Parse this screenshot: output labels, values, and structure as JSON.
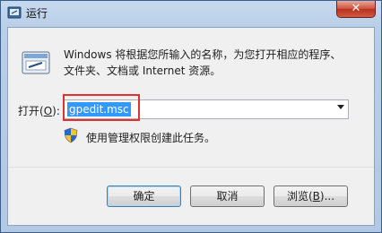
{
  "window": {
    "title": "运行",
    "close_symbol": "✕"
  },
  "dialog": {
    "description_line1": "Windows 将根据您所输入的名称，为您打开相应的程序、",
    "description_line2": "文件夹、文档或 Internet 资源。",
    "open_label_prefix": "打开(",
    "open_label_key": "O",
    "open_label_suffix": "):",
    "command_value": "gpedit.msc",
    "admin_note": "使用管理权限创建此任务。"
  },
  "buttons": {
    "ok_label": "确定",
    "cancel_label": "取消",
    "browse_prefix": "浏览(",
    "browse_key": "B",
    "browse_suffix": ")..."
  },
  "colors": {
    "highlight": "#e03030",
    "selection": "#3399ff"
  },
  "icons": [
    "run-app-icon",
    "run-program-icon",
    "uac-shield-icon",
    "dropdown-arrow-icon"
  ]
}
